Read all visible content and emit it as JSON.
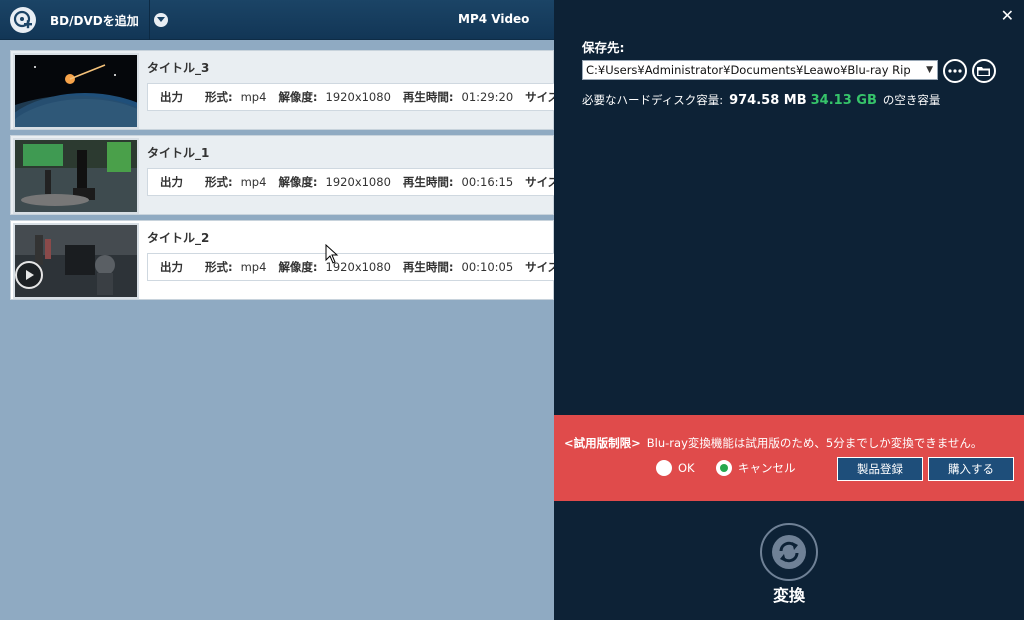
{
  "toolbar": {
    "add_label": "BD/DVDを追加",
    "profile": "MP4 Video"
  },
  "titles": [
    {
      "name": "タイトル_3",
      "output": "出力",
      "format_k": "形式:",
      "format_v": "mp4",
      "res_k": "解像度:",
      "res_v": "1920x1080",
      "dur_k": "再生時間:",
      "dur_v": "01:29:20",
      "size_k": "サイズ"
    },
    {
      "name": "タイトル_1",
      "output": "出力",
      "format_k": "形式:",
      "format_v": "mp4",
      "res_k": "解像度:",
      "res_v": "1920x1080",
      "dur_k": "再生時間:",
      "dur_v": "00:16:15",
      "size_k": "サイズ"
    },
    {
      "name": "タイトル_2",
      "output": "出力",
      "format_k": "形式:",
      "format_v": "mp4",
      "res_k": "解像度:",
      "res_v": "1920x1080",
      "dur_k": "再生時間:",
      "dur_v": "00:10:05",
      "size_k": "サイズ"
    }
  ],
  "panel": {
    "save_label": "保存先:",
    "path": "C:¥Users¥Administrator¥Documents¥Leawo¥Blu-ray Rip",
    "disk_label": "必要なハードディスク容量:",
    "required": "974.58 MB",
    "free": "34.13 GB",
    "free_suffix": "の空き容量",
    "close": "✕"
  },
  "banner": {
    "tag": "<試用版制限>",
    "message": "Blu-ray変換機能は試用版のため、5分までしか変換できません。",
    "ok": "OK",
    "cancel": "キャンセル",
    "register": "製品登録",
    "buy": "購入する",
    "selected": "cancel"
  },
  "convert": {
    "label": "変換"
  },
  "colors": {
    "panel_bg": "#0d2236",
    "banner_bg": "#e04b4b",
    "free_green": "#36c46a",
    "list_bg": "#8faac2"
  }
}
